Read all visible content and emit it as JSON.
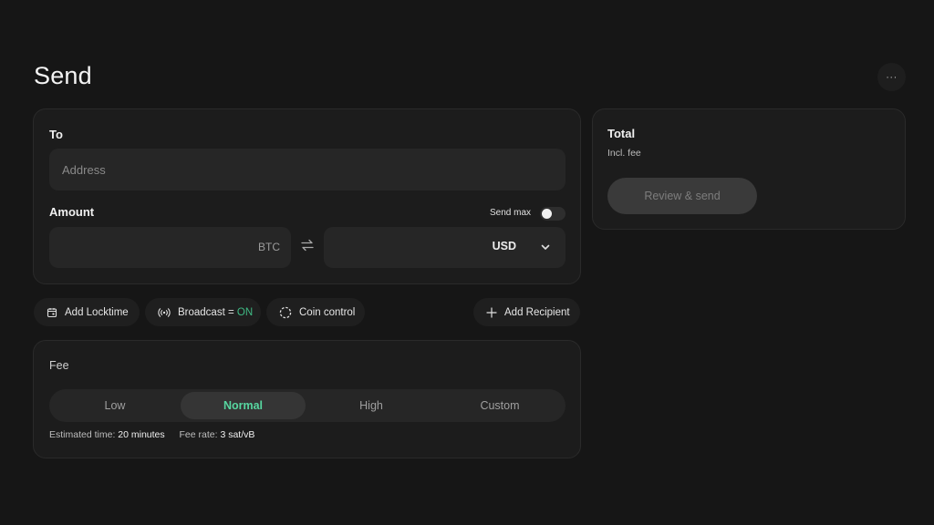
{
  "page": {
    "title": "Send",
    "more_label": "···"
  },
  "send_form": {
    "to_label": "To",
    "address_placeholder": "Address",
    "amount_label": "Amount",
    "send_max_label": "Send max",
    "send_max_on": false,
    "btc_unit": "BTC",
    "fiat_unit": "USD"
  },
  "actions": {
    "locktime_label": "Add Locktime",
    "broadcast_label": "Broadcast =",
    "broadcast_state": "ON",
    "coin_control_label": "Coin control",
    "add_recipient_label": "Add Recipient"
  },
  "total": {
    "title": "Total",
    "subtitle": "Incl. fee",
    "review_button": "Review & send"
  },
  "fee": {
    "label": "Fee",
    "options": [
      "Low",
      "Normal",
      "High",
      "Custom"
    ],
    "selected": "Normal",
    "estimated_time_label": "Estimated time:",
    "estimated_time_value": "20 minutes",
    "fee_rate_label": "Fee rate:",
    "fee_rate_value": "3 sat/vB"
  },
  "colors": {
    "background": "#161616",
    "card": "#1c1c1c",
    "accent_green": "#57d6a0",
    "on_green": "#3fba84"
  },
  "icons": [
    "ellipsis-icon",
    "swap-icon",
    "chevron-down-icon",
    "calendar-icon",
    "broadcast-icon",
    "coin-control-icon",
    "plus-icon"
  ]
}
